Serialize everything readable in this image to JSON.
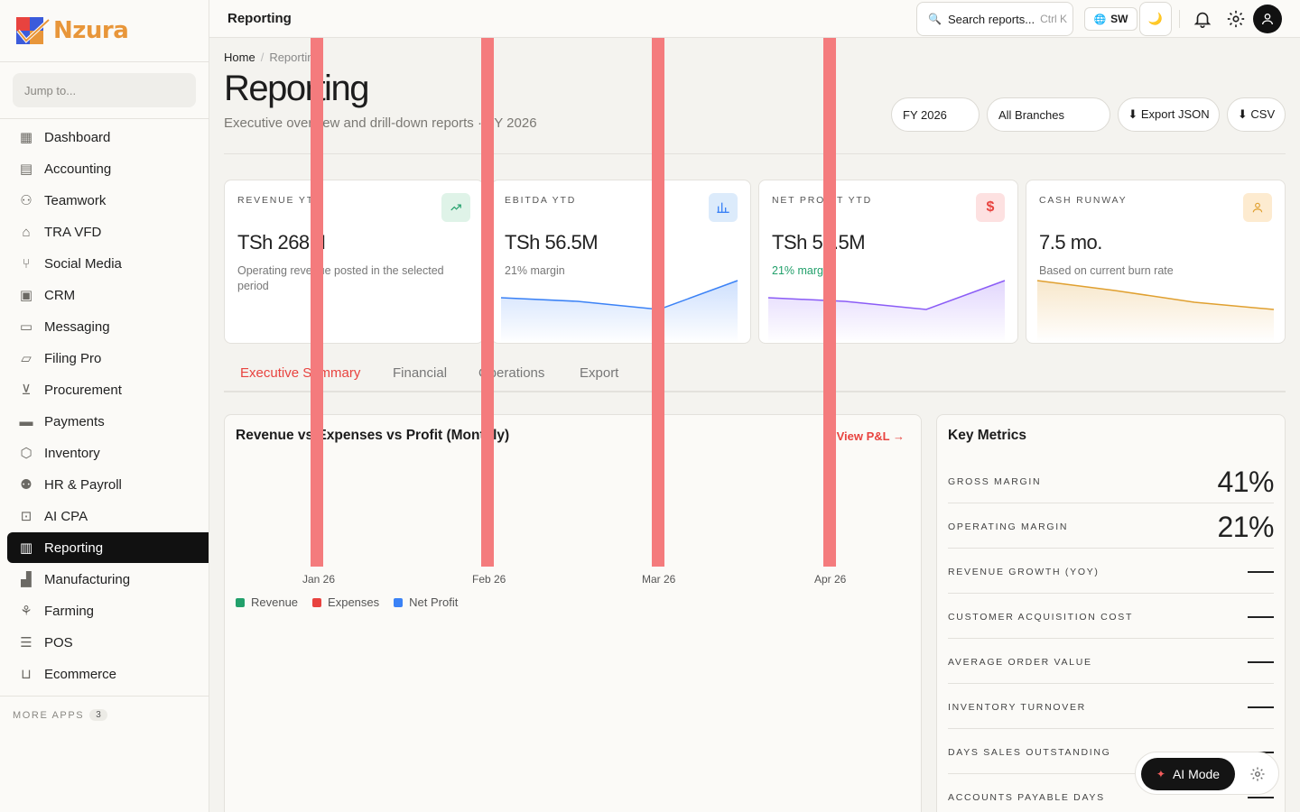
{
  "brand": {
    "name": "Nzura"
  },
  "sidebar": {
    "jump_placeholder": "Jump to...",
    "items": [
      {
        "label": "Dashboard",
        "icon": "grid-icon"
      },
      {
        "label": "Accounting",
        "icon": "table-icon"
      },
      {
        "label": "Teamwork",
        "icon": "people-icon"
      },
      {
        "label": "TRA VFD",
        "icon": "bank-icon"
      },
      {
        "label": "Social Media",
        "icon": "share-icon"
      },
      {
        "label": "CRM",
        "icon": "contact-icon"
      },
      {
        "label": "Messaging",
        "icon": "chat-icon"
      },
      {
        "label": "Filing Pro",
        "icon": "folder-icon"
      },
      {
        "label": "Procurement",
        "icon": "cart-icon"
      },
      {
        "label": "Payments",
        "icon": "card-icon"
      },
      {
        "label": "Inventory",
        "icon": "box-icon"
      },
      {
        "label": "HR & Payroll",
        "icon": "users-icon"
      },
      {
        "label": "AI CPA",
        "icon": "robot-icon"
      },
      {
        "label": "Reporting",
        "icon": "bar-chart-icon",
        "active": true
      },
      {
        "label": "Manufacturing",
        "icon": "factory-icon"
      },
      {
        "label": "Farming",
        "icon": "plant-icon"
      },
      {
        "label": "POS",
        "icon": "receipt-icon"
      },
      {
        "label": "Ecommerce",
        "icon": "bag-icon"
      }
    ],
    "more_label": "MORE APPS",
    "more_count": "3"
  },
  "topbar": {
    "title": "Reporting",
    "search_label": "Search reports...",
    "search_shortcut": "Ctrl K",
    "lang": "SW"
  },
  "page": {
    "breadcrumb_home": "Home",
    "breadcrumb_sep": "/",
    "breadcrumb_current": "Reporting",
    "title": "Reporting",
    "subtitle": "Executive overview and drill-down reports · FY 2026",
    "fy_select": "FY 2026",
    "branch_select": "All Branches",
    "export_json": "⬇ Export JSON",
    "export_csv": "⬇ CSV"
  },
  "kpis": [
    {
      "label": "REVENUE YTD",
      "value": "TSh 268M",
      "note": "Operating revenue posted in the selected period",
      "icon": "trend-up-icon",
      "color": "#22a06b"
    },
    {
      "label": "EBITDA YTD",
      "value": "TSh 56.5M",
      "note": "21% margin",
      "icon": "bar-chart-icon",
      "color": "#3b82f6",
      "spark": [
        0.18,
        0.22,
        0.4,
        -0.55
      ]
    },
    {
      "label": "NET PROFIT YTD",
      "value": "TSh 56.5M",
      "note": "21% margin",
      "note_color": "#22a06b",
      "icon": "dollar-icon",
      "color": "#8b5cf6",
      "spark": [
        0.18,
        0.22,
        0.4,
        -0.55
      ]
    },
    {
      "label": "CASH RUNWAY",
      "value": "7.5 mo.",
      "note": "Based on current burn rate",
      "icon": "person-icon",
      "color": "#e0a030",
      "spark": [
        0.0,
        0.3,
        0.75,
        1.0
      ]
    }
  ],
  "tabs": [
    {
      "label": "Executive Summary",
      "active": true
    },
    {
      "label": "Financial"
    },
    {
      "label": "Operations"
    },
    {
      "label": "Export"
    }
  ],
  "chart": {
    "title": "Revenue vs Expenses vs Profit (Monthly)",
    "link": "View P&L →",
    "legend": [
      {
        "name": "Revenue",
        "color": "#22a06b"
      },
      {
        "name": "Expenses",
        "color": "#e8433f"
      },
      {
        "name": "Net Profit",
        "color": "#3b82f6"
      }
    ]
  },
  "chart_data": {
    "type": "bar",
    "title": "Revenue vs Expenses vs Profit (Monthly)",
    "categories": [
      "Jan 26",
      "Feb 26",
      "Mar 26",
      "Apr 26"
    ],
    "series": [
      {
        "name": "Expenses",
        "values": [
          1,
          1,
          1,
          1
        ]
      }
    ]
  },
  "key_metrics": {
    "title": "Key Metrics",
    "rows": [
      {
        "label": "GROSS MARGIN",
        "value": "41%"
      },
      {
        "label": "OPERATING MARGIN",
        "value": "21%"
      },
      {
        "label": "REVENUE GROWTH (YOY)",
        "value": "—"
      },
      {
        "label": "CUSTOMER ACQUISITION COST",
        "value": "—"
      },
      {
        "label": "AVERAGE ORDER VALUE",
        "value": "—"
      },
      {
        "label": "INVENTORY TURNOVER",
        "value": "—"
      },
      {
        "label": "DAYS SALES OUTSTANDING",
        "value": "—"
      },
      {
        "label": "ACCOUNTS PAYABLE DAYS",
        "value": "—"
      }
    ]
  },
  "ai": {
    "label": "AI Mode"
  }
}
